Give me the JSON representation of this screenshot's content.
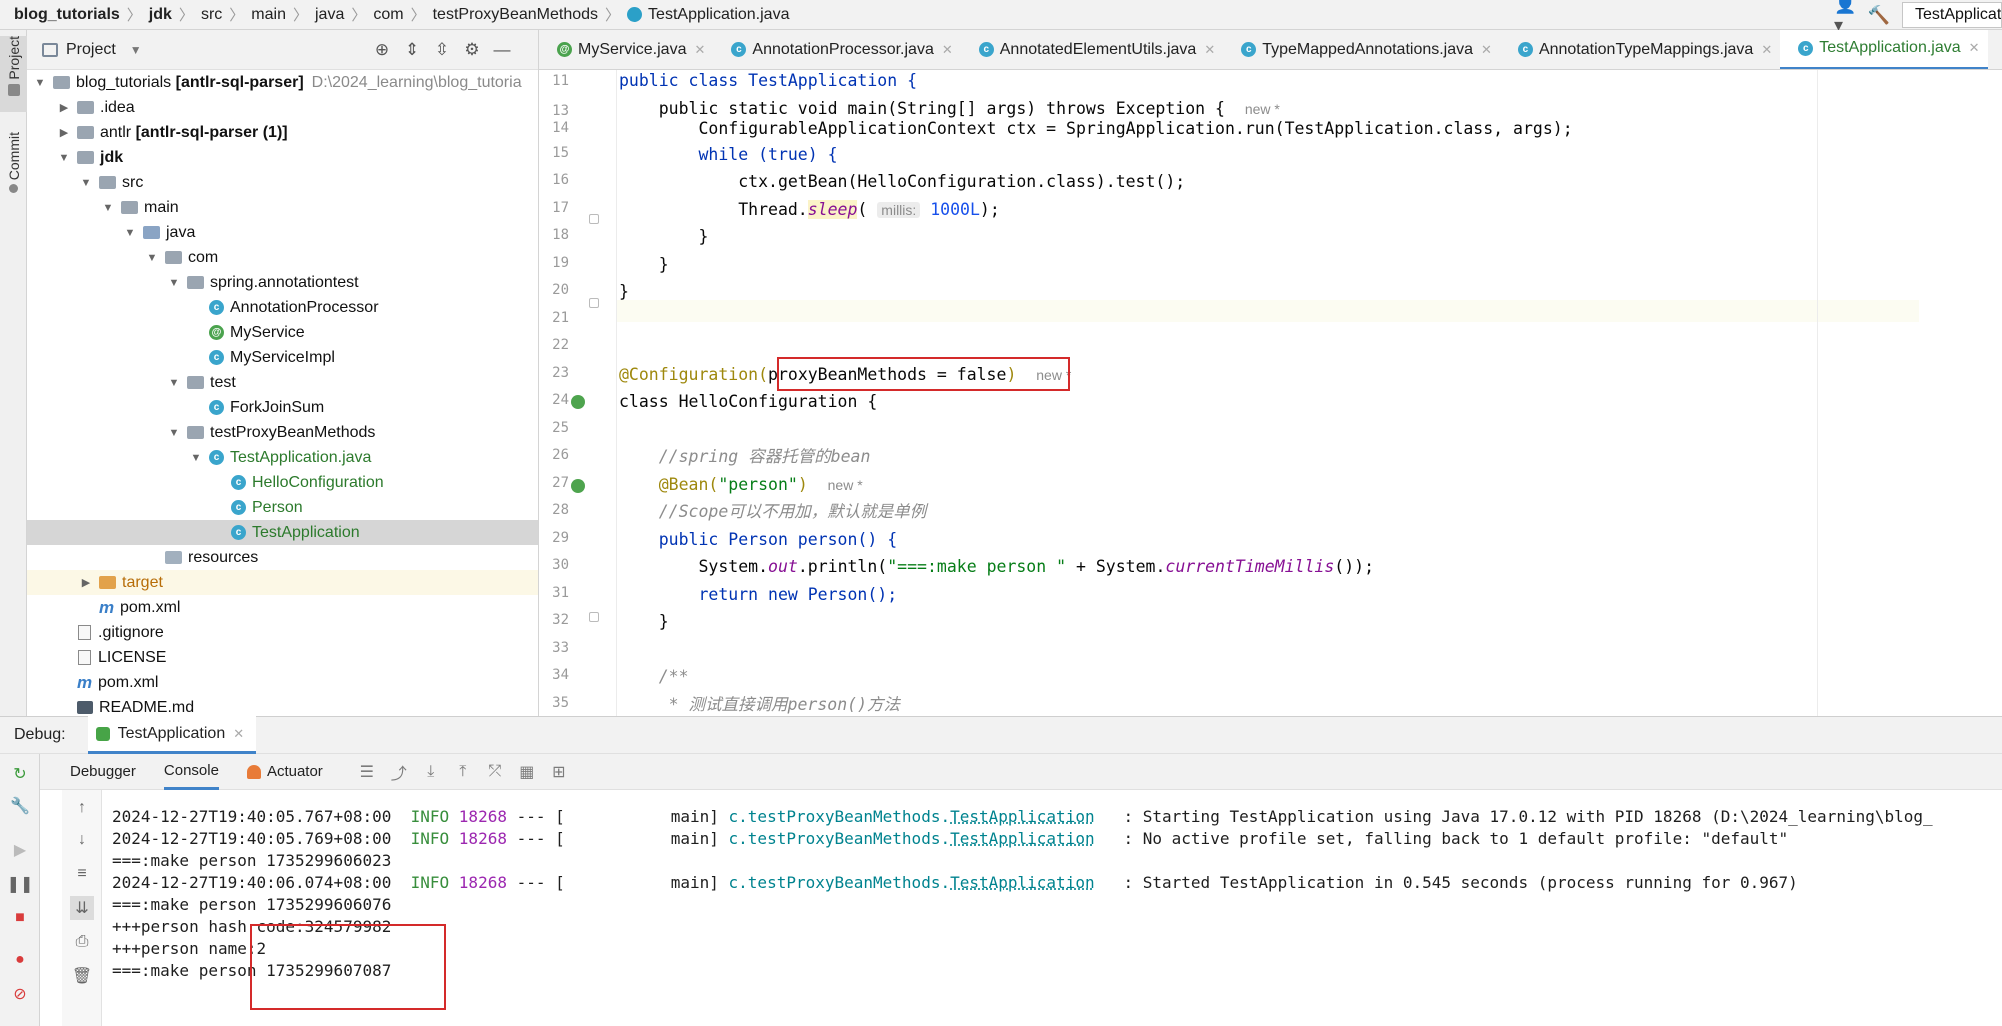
{
  "breadcrumb": [
    "blog_tutorials",
    "jdk",
    "src",
    "main",
    "java",
    "com",
    "testProxyBeanMethods",
    "TestApplication.java"
  ],
  "run_config": "TestApplication",
  "left_strip": {
    "project": "Project",
    "commit": "Commit"
  },
  "project_pane": {
    "title": "Project",
    "tree": [
      {
        "label": "blog_tutorials",
        "bold_suffix": "[antlr-sql-parser]",
        "path": "D:\\2024_learning\\blog_tutoria"
      },
      {
        "label": ".idea"
      },
      {
        "label": "antlr",
        "bold_suffix": "[antlr-sql-parser (1)]"
      },
      {
        "label": "jdk"
      },
      {
        "label": "src"
      },
      {
        "label": "main"
      },
      {
        "label": "java"
      },
      {
        "label": "com"
      },
      {
        "label": "spring.annotationtest"
      },
      {
        "label": "AnnotationProcessor"
      },
      {
        "label": "MyService"
      },
      {
        "label": "MyServiceImpl"
      },
      {
        "label": "test"
      },
      {
        "label": "ForkJoinSum"
      },
      {
        "label": "testProxyBeanMethods"
      },
      {
        "label": "TestApplication.java"
      },
      {
        "label": "HelloConfiguration"
      },
      {
        "label": "Person"
      },
      {
        "label": "TestApplication"
      },
      {
        "label": "resources"
      },
      {
        "label": "target"
      },
      {
        "label": "pom.xml"
      },
      {
        "label": ".gitignore"
      },
      {
        "label": "LICENSE"
      },
      {
        "label": "pom.xml"
      },
      {
        "label": "README.md"
      }
    ]
  },
  "editor_tabs": [
    {
      "label": "MyService.java"
    },
    {
      "label": "AnnotationProcessor.java"
    },
    {
      "label": "AnnotatedElementUtils.java"
    },
    {
      "label": "TypeMappedAnnotations.java"
    },
    {
      "label": "AnnotationTypeMappings.java"
    },
    {
      "label": "TestApplication.java"
    }
  ],
  "editor": {
    "line_numbers": [
      "11",
      "13",
      "14",
      "15",
      "16",
      "17",
      "18",
      "19",
      "20",
      "21",
      "22",
      "23",
      "24",
      "25",
      "26",
      "27",
      "28",
      "29",
      "30",
      "31",
      "32",
      "33",
      "34",
      "35"
    ],
    "lines": {
      "l11": "public class TestApplication {",
      "l13a": "    public static void main(String[] args) throws Exception {",
      "l13_hint": "new *",
      "l14": "        ConfigurableApplicationContext ctx = SpringApplication.run(TestApplication.class, args);",
      "l15": "        while (true) {",
      "l16": "            ctx.getBean(HelloConfiguration.class).test();",
      "l17a": "            Thread.",
      "l17_sleep": "sleep",
      "l17b": "(",
      "l17_param": "millis:",
      "l17_num": "1000L",
      "l17c": ");",
      "l18": "        }",
      "l19": "    }",
      "l20": "}",
      "l23_ann": "@Configuration(",
      "l23_param": "proxyBeanMethods = false",
      "l23_end": ")",
      "l23_hint": "new *",
      "l24": "class HelloConfiguration {",
      "l26": "    //spring 容器托管的bean",
      "l27_ann": "    @Bean(",
      "l27_str": "\"person\"",
      "l27_end": ")",
      "l27_hint": "new *",
      "l28": "    //Scope可以不用加，默认就是单例",
      "l29": "    public Person person() {",
      "l30a": "        System.",
      "l30_out": "out",
      "l30b": ".println(",
      "l30_str": "\"===:make person \"",
      "l30c": " + System.",
      "l30_m": "currentTimeMillis",
      "l30d": "());",
      "l31": "        return new Person();",
      "l32": "    }",
      "l34": "    /**",
      "l35": "     * 测试直接调用person()方法"
    }
  },
  "debug": {
    "label": "Debug:",
    "session": "TestApplication",
    "tabs": [
      "Debugger",
      "Console",
      "Actuator"
    ],
    "console_lines": [
      {
        "ts": "2024-12-27T19:40:05.767+08:00",
        "level": "INFO",
        "pid": "18268",
        "mid": " --- [           main] ",
        "logger_prefix": "c.testProxyBeanMethods.",
        "logger_class": "TestApplication",
        "msg": "   : Starting TestApplication using Java 17.0.12 with PID 18268 (D:\\2024_learning\\blog_"
      },
      {
        "ts": "2024-12-27T19:40:05.769+08:00",
        "level": "INFO",
        "pid": "18268",
        "mid": " --- [           main] ",
        "logger_prefix": "c.testProxyBeanMethods.",
        "logger_class": "TestApplication",
        "msg": "   : No active profile set, falling back to 1 default profile: \"default\""
      },
      {
        "plain": "===:make person 1735299606023"
      },
      {
        "ts": "2024-12-27T19:40:06.074+08:00",
        "level": "INFO",
        "pid": "18268",
        "mid": " --- [           main] ",
        "logger_prefix": "c.testProxyBeanMethods.",
        "logger_class": "TestApplication",
        "msg": "   : Started TestApplication in 0.545 seconds (process running for 0.967)"
      },
      {
        "plain": "===:make person 1735299606076"
      },
      {
        "plain": "+++person hash code:324579982"
      },
      {
        "plain": "+++person name:2"
      },
      {
        "plain": "===:make person 1735299607087"
      }
    ]
  }
}
